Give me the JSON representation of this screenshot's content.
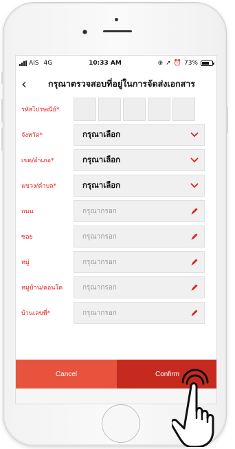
{
  "status_bar": {
    "carrier": "AIS",
    "network": "4G",
    "time": "10:33 AM",
    "battery": "73%",
    "battery_level": 0.73
  },
  "nav": {
    "back_icon": "chevron-left-icon",
    "title": "กรุณาตรวจสอบที่อยู่ในการจัดส่งเอกสาร"
  },
  "form": {
    "postal_code": {
      "label": "รหัสไปรษณีย์*",
      "boxes": 5
    },
    "province": {
      "label": "จังหวัด*",
      "value": "กรุณาเลือก"
    },
    "district": {
      "label": "เขต/อำเภอ*",
      "value": "กรุณาเลือก"
    },
    "subdistrict": {
      "label": "แขวง/ตำบล*",
      "value": "กรุณาเลือก"
    },
    "road": {
      "label": "ถนน",
      "placeholder": "กรุณากรอก"
    },
    "soi": {
      "label": "ซอย",
      "placeholder": "กรุณากรอก"
    },
    "moo": {
      "label": "หมู่",
      "placeholder": "กรุณากรอก"
    },
    "village": {
      "label": "หมู่บ้าน/คอนโด",
      "placeholder": "กรุณากรอก"
    },
    "house_no": {
      "label": "บ้านเลขที่*",
      "placeholder": "กรุณากรอก"
    }
  },
  "actions": {
    "cancel_label": "Cancel",
    "confirm_label": "Confirm"
  },
  "colors": {
    "accent": "#e21f1f",
    "cancel_bg": "#e8533d",
    "confirm_bg": "#c62a1f"
  }
}
